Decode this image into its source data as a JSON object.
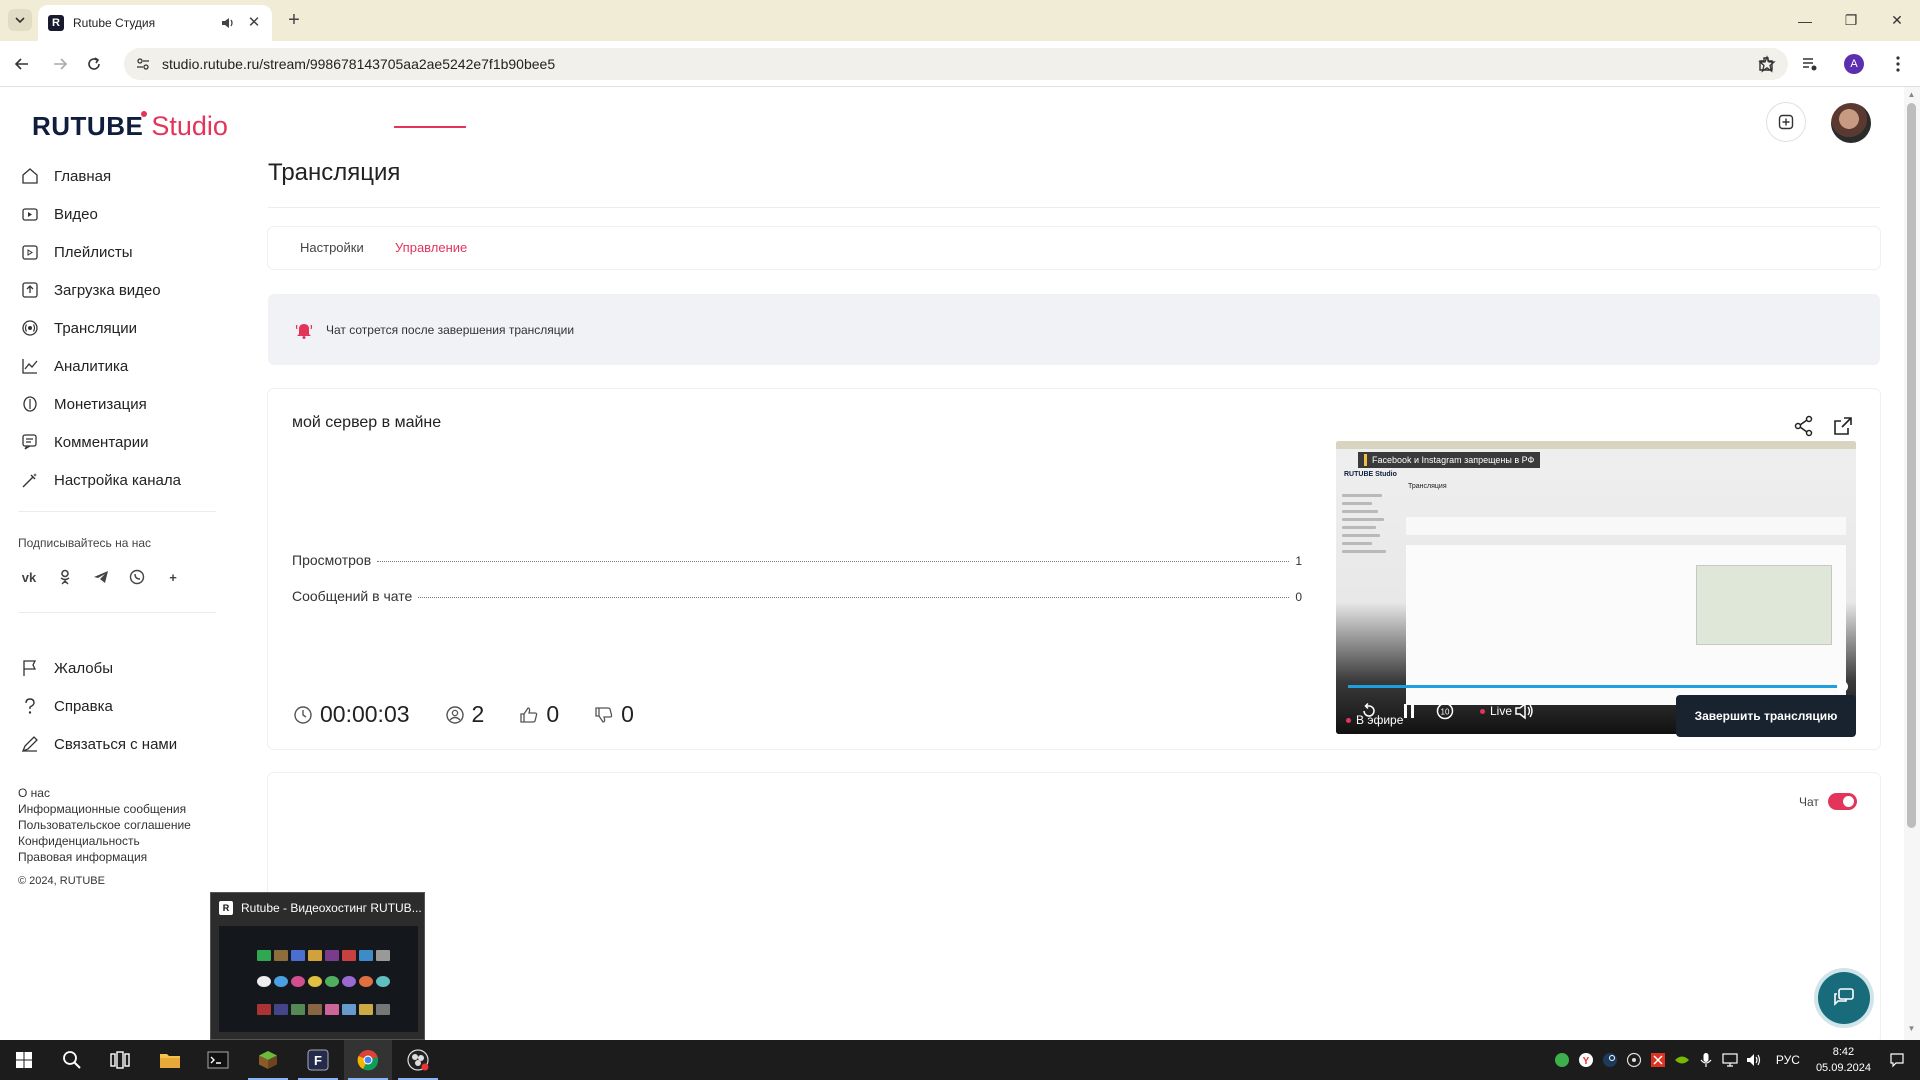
{
  "browser": {
    "tab_title": "Rutube Студия",
    "url": "studio.rutube.ru/stream/998678143705aa2ae5242e7f1b90bee5"
  },
  "logo": {
    "rutube": "RUTUBE",
    "studio": "Studio"
  },
  "sidebar": {
    "items": [
      {
        "label": "Главная",
        "icon": "home-icon"
      },
      {
        "label": "Видео",
        "icon": "video-icon"
      },
      {
        "label": "Плейлисты",
        "icon": "playlist-icon"
      },
      {
        "label": "Загрузка видео",
        "icon": "upload-icon"
      },
      {
        "label": "Трансляции",
        "icon": "broadcast-icon"
      },
      {
        "label": "Аналитика",
        "icon": "analytics-icon"
      },
      {
        "label": "Монетизация",
        "icon": "monetization-icon"
      },
      {
        "label": "Комментарии",
        "icon": "comments-icon"
      },
      {
        "label": "Настройка канала",
        "icon": "channel-settings-icon"
      }
    ],
    "follow_title": "Подписывайтесь на нас",
    "socials": [
      "vk-icon",
      "ok-icon",
      "telegram-icon",
      "viber-icon",
      "more-icon"
    ],
    "secondary": [
      {
        "label": "Жалобы",
        "icon": "flag-icon"
      },
      {
        "label": "Справка",
        "icon": "help-icon"
      },
      {
        "label": "Связаться с нами",
        "icon": "contact-icon"
      }
    ],
    "footer_links": [
      "О нас",
      "Информационные сообщения",
      "Пользовательское соглашение",
      "Конфиденциальность",
      "Правовая информация"
    ],
    "copyright": "© 2024, RUTUBE"
  },
  "page": {
    "title": "Трансляция",
    "tabs": [
      {
        "label": "Настройки",
        "active": false
      },
      {
        "label": "Управление",
        "active": true
      }
    ],
    "notice": "Чат сотрется после завершения трансляции"
  },
  "stream": {
    "title": "мой сервер в майне",
    "stats": [
      {
        "label": "Просмотров",
        "value": "1"
      },
      {
        "label": "Сообщений в чате",
        "value": "0"
      }
    ],
    "duration": "00:00:03",
    "viewers": "2",
    "likes": "0",
    "dislikes": "0",
    "end_button": "Завершить трансляцию",
    "player": {
      "banner": "Facebook и Instagram запрещены в РФ",
      "on_air": "В эфире",
      "live": "Live",
      "progress": 1.0,
      "mini_logo": "RUTUBE Studio",
      "mini_title": "Трансляция"
    }
  },
  "chat": {
    "label": "Чат",
    "enabled": true
  },
  "taskbar_preview": {
    "title": "Rutube - Видеохостинг RUTUB..."
  },
  "tray": {
    "lang": "РУС",
    "time": "8:42",
    "date": "05.09.2024"
  },
  "colors": {
    "accent": "#e3355b",
    "brand_dark": "#0f1e3c",
    "button_dark": "#18232f",
    "support": "#176b7a"
  }
}
